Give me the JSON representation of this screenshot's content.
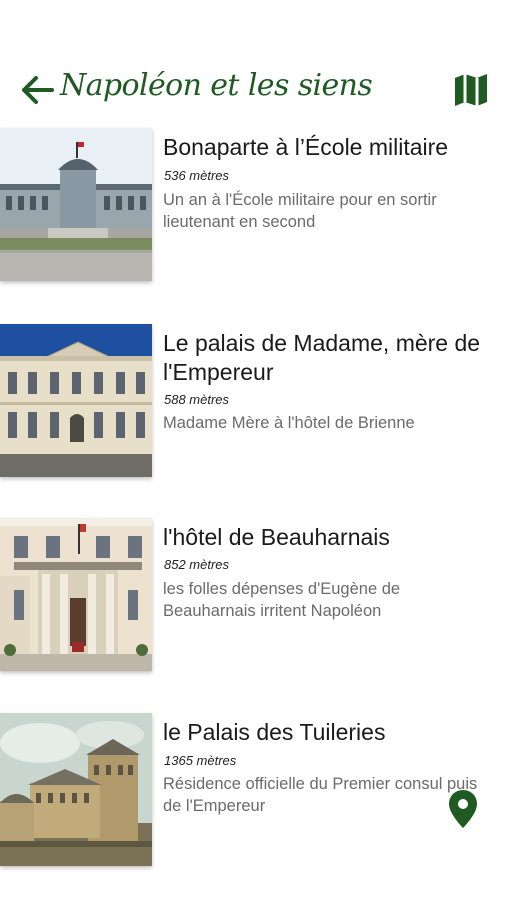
{
  "header": {
    "title": "Napoléon et les siens",
    "back_icon": "arrow-left-icon",
    "map_icon": "map-icon",
    "accent_color": "#1f5a22"
  },
  "items": [
    {
      "title": "Bonaparte à l’École militaire",
      "distance": "536 mètres",
      "description": "Un an à l'École militaire pour en sortir lieutenant en second"
    },
    {
      "title": "Le palais de Madame, mère de l'Empereur",
      "distance": "588 mètres",
      "description": "Madame Mère à l'hôtel de Brienne"
    },
    {
      "title": "l'hôtel de Beauharnais",
      "distance": "852 mètres",
      "description": "les folles dépenses d'Eugène de Beauharnais irritent Napoléon"
    },
    {
      "title": "le Palais des Tuileries",
      "distance": "1365 mètres",
      "description": "Résidence officielle du Premier consul puis de l'Empereur"
    }
  ],
  "fab": {
    "icon": "location-pin-icon",
    "color": "#1f5a22"
  }
}
